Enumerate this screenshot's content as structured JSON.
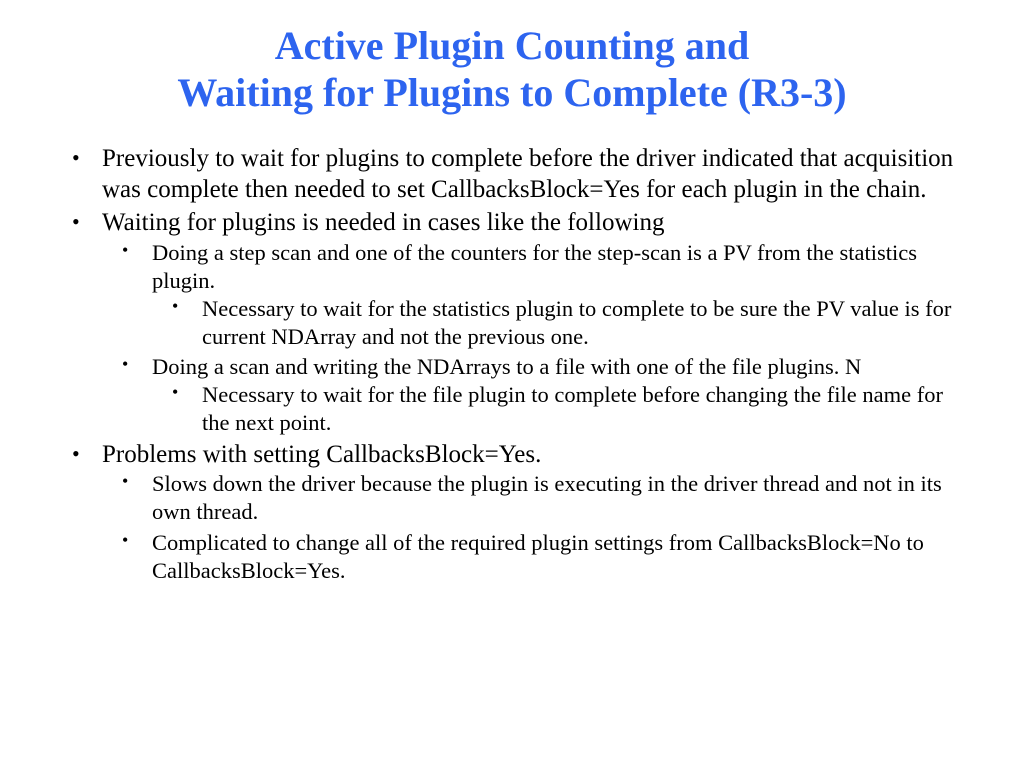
{
  "title_line1": "Active Plugin Counting and",
  "title_line2": "Waiting for Plugins to Complete (R3-3)",
  "bullets": {
    "b1": "Previously to wait for plugins to complete before the driver indicated that acquisition was complete then needed to set CallbacksBlock=Yes for each plugin in the chain.",
    "b2": "Waiting for plugins is needed in cases like the following",
    "b2_1": "Doing a step scan and one of the counters for the step-scan is a PV from the statistics plugin.",
    "b2_1_1": "Necessary to wait for the statistics plugin to complete to be sure the PV value is for current NDArray and not the previous one.",
    "b2_2": "Doing a scan and writing the NDArrays to a file with one of the file plugins. N",
    "b2_2_1": "Necessary to wait for the file plugin to complete before changing the file name for the next point.",
    "b3": "Problems with setting CallbacksBlock=Yes.",
    "b3_1": "Slows down the driver because the plugin is executing in the driver thread and not in its own thread.",
    "b3_2": "Complicated to change all of the required plugin settings from CallbacksBlock=No to CallbacksBlock=Yes."
  }
}
